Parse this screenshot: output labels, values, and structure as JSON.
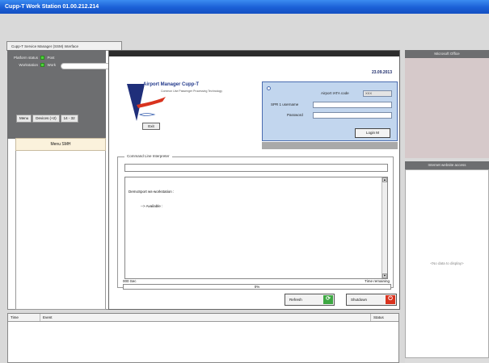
{
  "window": {
    "title": "Cupp-T Work Station  01.00.212.214"
  },
  "tabs": [
    {
      "label": "Cupp-T Service Manager (SSM) Interface"
    }
  ],
  "status": {
    "platform_label": "Platform status",
    "platform_value": "Post",
    "workstation_label": "Workstation",
    "workstation_value": "Work",
    "led_color": "#4ed03c"
  },
  "left_menu": {
    "tabs": [
      "Menu",
      "Devices (+2)",
      "14 - 32"
    ],
    "panel_title": "Menu SMH"
  },
  "dialog": {
    "date": "23.09.2013",
    "app_name": "Airport Manager Cupp-T",
    "app_subtitle": "Common Use Passenger Processing Technology",
    "exit_label": "Exit",
    "login": {
      "iata_label": "Airport IATA code",
      "iata_value": "XXX",
      "username_label": "SPR 1 username",
      "password_label": "Password",
      "button_label": "Login M"
    },
    "cli": {
      "legend": "Command Line Interpreter",
      "output_lines": [
        "DemoSport ws-workstation :",
        "            --> Available :"
      ]
    },
    "progress": {
      "left_text": "000  Sec",
      "right_text": "Time remaining",
      "percent_label": "0%"
    },
    "actions": [
      {
        "label": "Refresh",
        "icon": "refresh-icon",
        "color": "#3ea843"
      },
      {
        "label": "Shutdown",
        "icon": "power-icon",
        "color": "#d9331e"
      }
    ]
  },
  "right_panels": {
    "top_title": "Microsoft Office",
    "bottom_title": "Internet website access",
    "no_data": "<No data to display>"
  },
  "event_log": {
    "columns": [
      "Time",
      "Event",
      "Status"
    ]
  },
  "colors": {
    "title_blue": "#1a5fd6",
    "panel_grey": "#6d6e70",
    "login_blue": "#c2d6ee",
    "accent_red": "#d9331e"
  }
}
